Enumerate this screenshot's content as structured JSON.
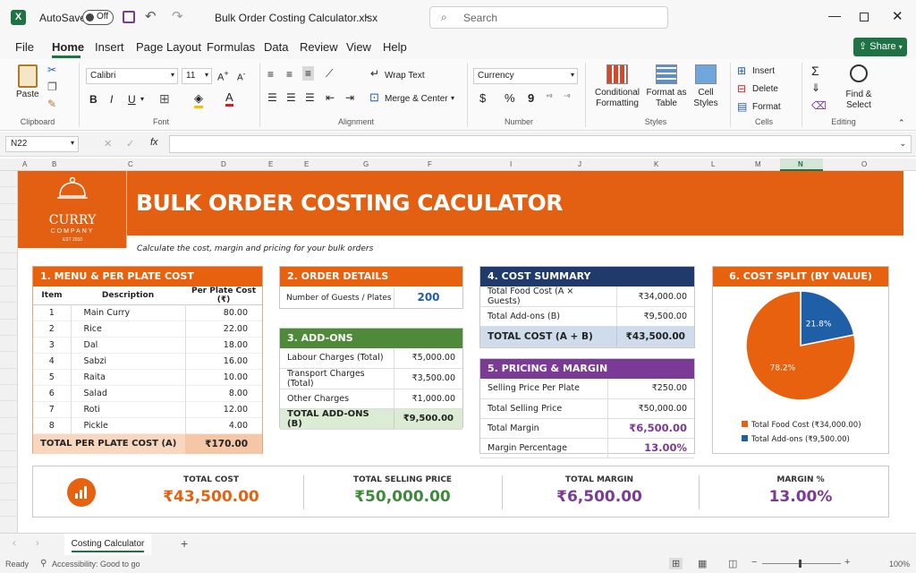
{
  "titlebar": {
    "autosave_label": "AutoSave",
    "autosave_state": "Off",
    "filename": "Bulk Order Costing Calculator.xlsx",
    "search_placeholder": "Search"
  },
  "menu": {
    "items": [
      "File",
      "Home",
      "Insert",
      "Page Layout",
      "Formulas",
      "Data",
      "Review",
      "View",
      "Help"
    ],
    "active": "Home",
    "share_label": "Share"
  },
  "ribbon": {
    "clipboard": {
      "paste": "Paste",
      "label": "Clipboard"
    },
    "font": {
      "name": "Calibri",
      "size": "11",
      "label": "Font",
      "bold": "B",
      "italic": "I",
      "underline": "U"
    },
    "alignment": {
      "wrap": "Wrap Text",
      "merge": "Merge & Center",
      "label": "Alignment"
    },
    "number": {
      "format": "Currency",
      "label": "Number",
      "currency_symbol": "$",
      "percent": "%",
      "comma": "9"
    },
    "styles": {
      "conditional": "Conditional Formatting",
      "format_table": "Format as Table",
      "cell_styles": "Cell Styles",
      "label": "Styles"
    },
    "cells": {
      "insert": "Insert",
      "delete": "Delete",
      "format": "Format",
      "label": "Cells"
    },
    "editing": {
      "find": "Find & Select",
      "label": "Editing"
    }
  },
  "formula_bar": {
    "name_box": "N22",
    "fx": "fx",
    "value": ""
  },
  "columns": [
    "A",
    "B",
    "C",
    "D",
    "E",
    "E",
    "G",
    "F",
    "I",
    "J",
    "K",
    "L",
    "M",
    "N",
    "O"
  ],
  "active_column": "N",
  "header": {
    "logo_top": "CURRY",
    "logo_bottom": "COMPANY",
    "logo_est": "EST 2010",
    "title": "BULK ORDER COSTING CACULATOR",
    "subtitle": "Calculate the cost, margin and pricing for your bulk orders"
  },
  "menu_cost": {
    "heading": "1. MENU & PER PLATE COST",
    "columns": [
      "Item",
      "Description",
      "Per Plate Cost (₹)"
    ],
    "rows": [
      {
        "item": "1",
        "desc": "Main Curry",
        "cost": "80.00"
      },
      {
        "item": "2",
        "desc": "Rice",
        "cost": "22.00"
      },
      {
        "item": "3",
        "desc": "Dal",
        "cost": "18.00"
      },
      {
        "item": "4",
        "desc": "Sabzi",
        "cost": "16.00"
      },
      {
        "item": "5",
        "desc": "Raita",
        "cost": "10.00"
      },
      {
        "item": "6",
        "desc": "Salad",
        "cost": "8.00"
      },
      {
        "item": "7",
        "desc": "Roti",
        "cost": "12.00"
      },
      {
        "item": "8",
        "desc": "Pickle",
        "cost": "4.00"
      }
    ],
    "total_label": "TOTAL PER PLATE COST (A)",
    "total_value": "₹170.00"
  },
  "order": {
    "heading": "2. ORDER DETAILS",
    "label": "Number of Guests / Plates",
    "value": "200"
  },
  "addons": {
    "heading": "3. ADD-ONS",
    "rows": [
      {
        "label": "Labour Charges (Total)",
        "value": "₹5,000.00"
      },
      {
        "label": "Transport Charges (Total)",
        "value": "₹3,500.00"
      },
      {
        "label": "Other Charges",
        "value": "₹1,000.00"
      }
    ],
    "total_label": "TOTAL ADD-ONS (B)",
    "total_value": "₹9,500.00"
  },
  "cost_summary": {
    "heading": "4. COST SUMMARY",
    "rows": [
      {
        "label": "Total Food Cost (A × Guests)",
        "value": "₹34,000.00"
      },
      {
        "label": "Total Add-ons (B)",
        "value": "₹9,500.00"
      }
    ],
    "total_label": "TOTAL COST (A + B)",
    "total_value": "₹43,500.00"
  },
  "pricing": {
    "heading": "5. PRICING & MARGIN",
    "rows": [
      {
        "label": "Selling Price Per Plate",
        "value": "₹250.00"
      },
      {
        "label": "Total Selling Price",
        "value": "₹50,000.00"
      },
      {
        "label": "Total Margin",
        "value": "₹6,500.00"
      },
      {
        "label": "Margin Percentage",
        "value": "13.00%"
      }
    ]
  },
  "chart_data": {
    "type": "pie",
    "title": "6. COST SPLIT (BY VALUE)",
    "categories": [
      "Total Food Cost (₹34,000.00)",
      "Total Add-ons (₹9,500.00)"
    ],
    "values": [
      34000,
      9500
    ],
    "data_labels": [
      "78.2%",
      "21.8%"
    ],
    "colors": [
      "#e8610f",
      "#1f5fa8"
    ],
    "legend": "bottom"
  },
  "summary": {
    "items": [
      {
        "label": "TOTAL COST",
        "value": "₹43,500.00",
        "color": "#e8610f"
      },
      {
        "label": "TOTAL SELLING PRICE",
        "value": "₹50,000.00",
        "color": "#3f8a3a"
      },
      {
        "label": "TOTAL MARGIN",
        "value": "₹6,500.00",
        "color": "#7a3a96"
      },
      {
        "label": "MARGIN %",
        "value": "13.00%",
        "color": "#7a3a96"
      }
    ]
  },
  "sheet_tab": "Costing Calculator",
  "status": {
    "ready": "Ready",
    "accessibility": "Accessibility: Good to go",
    "zoom": "100%"
  },
  "colors": {
    "orange": "#e8610f",
    "navy": "#1f3a6b",
    "green": "#4f8a3a",
    "purple": "#7a3a96",
    "excel_green": "#1f7244"
  }
}
